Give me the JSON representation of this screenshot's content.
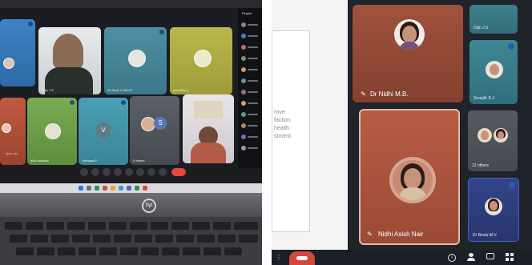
{
  "left_photo": {
    "people_panel_title": "People",
    "tiles": [
      {
        "name": ""
      },
      {
        "name": "Dijin J S"
      },
      {
        "name": "Dr Sunil J LMCST"
      },
      {
        "name": "parvathy g"
      },
      {
        "name": ""
      },
      {
        "name": "akhi saharan"
      },
      {
        "name": "Vismaya P",
        "initial": "V"
      },
      {
        "name": "5 others",
        "initial": "S"
      },
      {
        "name": ""
      }
    ],
    "meeting_time_text": "~ gpm-ald",
    "brand_logo_text": "hp"
  },
  "right_photo": {
    "doc_lines": [
      "rove",
      "faction",
      "health",
      "stment"
    ],
    "tiles": {
      "top_speaker": {
        "name": "Dr Nidhi M.B."
      },
      "main_speaker": {
        "name": "Nidhi Asish Nair"
      },
      "dijin": {
        "name": "Dijin J S"
      },
      "sreejith": {
        "name": "Sreejith S J"
      },
      "others": {
        "name": "12 others"
      },
      "bindu": {
        "name": "Dr Bindu M.V."
      }
    },
    "toolbar_icons": [
      "more-icon",
      "end-call-icon",
      "info-icon",
      "people-icon",
      "chat-icon",
      "activities-icon"
    ]
  },
  "colors": {
    "end_call": "#d4483c",
    "tile_brown": "#9a4a37",
    "tile_dark_blue": "#2c3c73"
  }
}
